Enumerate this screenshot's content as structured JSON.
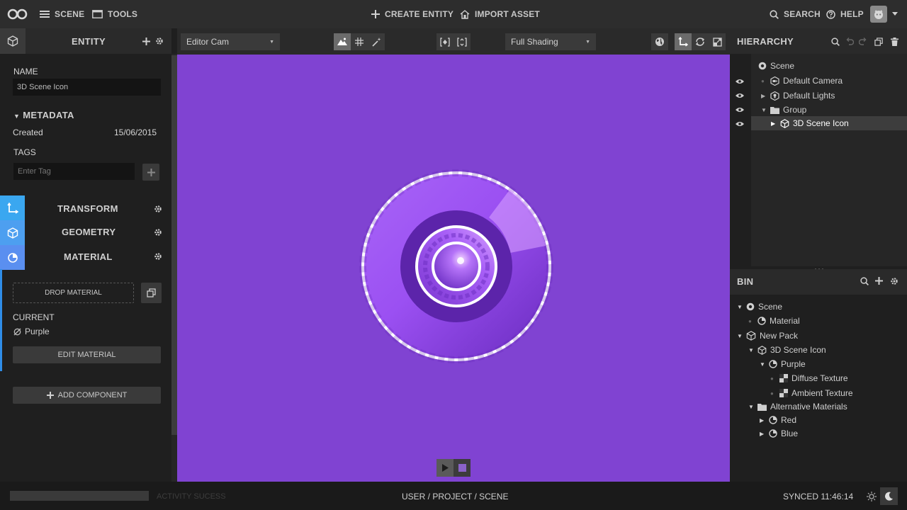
{
  "topbar": {
    "scene_label": "SCENE",
    "tools_label": "TOOLS",
    "create_entity_label": "CREATE ENTITY",
    "import_asset_label": "IMPORT ASSET",
    "search_label": "SEARCH",
    "help_label": "HELP"
  },
  "entity_panel": {
    "title": "ENTITY",
    "name_label": "NAME",
    "name_value": "3D Scene Icon",
    "metadata_label": "METADATA",
    "created_label": "Created",
    "created_value": "15/06/2015",
    "tags_label": "TAGS",
    "tag_placeholder": "Enter Tag",
    "sections": [
      "TRANSFORM",
      "GEOMETRY",
      "MATERIAL"
    ],
    "drop_material_label": "DROP MATERIAL",
    "current_label": "CURRENT",
    "current_material": "Purple",
    "edit_material_label": "EDIT MATERIAL",
    "add_component_label": "ADD COMPONENT"
  },
  "viewport_toolbar": {
    "camera": "Editor Cam",
    "shading": "Full Shading"
  },
  "viewport": {
    "background_color": "#8043d2"
  },
  "hierarchy": {
    "title": "HIERARCHY",
    "items": [
      {
        "label": "Scene",
        "icon": "scene-icon"
      },
      {
        "label": "Default Camera",
        "icon": "camera-icon"
      },
      {
        "label": "Default Lights",
        "icon": "light-icon"
      },
      {
        "label": "Group",
        "icon": "folder-icon"
      },
      {
        "label": "3D Scene Icon",
        "icon": "cube-icon",
        "selected": true
      }
    ]
  },
  "bin": {
    "title": "BIN",
    "items": [
      {
        "label": "Scene",
        "icon": "scene-icon"
      },
      {
        "label": "Material",
        "icon": "material-icon"
      },
      {
        "label": "New Pack",
        "icon": "pack-icon"
      },
      {
        "label": "3D Scene Icon",
        "icon": "cube-icon"
      },
      {
        "label": "Purple",
        "icon": "material-icon"
      },
      {
        "label": "Diffuse Texture",
        "icon": "texture-icon"
      },
      {
        "label": "Ambient Texture",
        "icon": "texture-icon"
      },
      {
        "label": "Alternative Materials",
        "icon": "folder-icon"
      },
      {
        "label": "Red",
        "icon": "material-icon"
      },
      {
        "label": "Blue",
        "icon": "material-icon"
      }
    ]
  },
  "status": {
    "activity": "ACTIVITY SUCESS",
    "breadcrumb": "USER / PROJECT / SCENE",
    "synced": "SYNCED 11:46:14"
  },
  "colors": {
    "accent": "#2f8de8",
    "tab_blue": "#4aa3f0",
    "viewport_purple": "#8043d2"
  }
}
